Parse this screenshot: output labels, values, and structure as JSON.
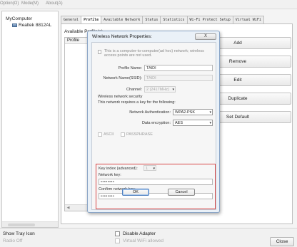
{
  "menu": {
    "items": [
      "Option(O)",
      "Mode(M)",
      "About(A)"
    ]
  },
  "tree": {
    "root": "MyComputer",
    "child": "Realtek 8812AL"
  },
  "tabs": [
    "General",
    "Profile",
    "Available Network",
    "Status",
    "Statistics",
    "Wi-Fi Protect Setup",
    "Virtual WiFi"
  ],
  "profile_panel": {
    "available_label": "Available Profile(s)",
    "list_header": "Profile",
    "buttons": [
      "Add",
      "Remove",
      "Edit",
      "Duplicate",
      "Set Default"
    ]
  },
  "bottom": {
    "show_tray": "Show Tray Icon",
    "radio_off": "Radio Off",
    "disable_adapter": "Disable Adapter",
    "virtual_wifi": "Virtual WiFi allowed",
    "close": "Close"
  },
  "dialog": {
    "title": "Wireless Network Properties:",
    "close_glyph": "X",
    "adhoc_text": "This is a computer-to-computer(ad hoc) network; wireless access points are not used.",
    "profile_name_label": "Profile Name:",
    "profile_name_value": "TAIDI",
    "ssid_label": "Network Name(SSID):",
    "ssid_value": "TAIDI",
    "channel_label": "Channel:",
    "channel_value": "2 (2417MHz)",
    "security_title": "Wireless network security",
    "security_text": "This network requires a key for the following:",
    "auth_label": "Network Authentication:",
    "auth_value": "WPA2-PSK",
    "enc_label": "Data encryption:",
    "enc_value": "AES",
    "ascii_label": "ASCII",
    "passphrase_label": "PASSPHRASE",
    "key_index_label": "Key index (advanced):",
    "key_index_value": "1",
    "network_key_label": "Network key:",
    "network_key_value": "••••••••",
    "confirm_key_label": "Confirm network key:",
    "confirm_key_value": "••••••••",
    "ok": "OK",
    "cancel": "Cancel"
  },
  "colors": {
    "highlight_box": "#d94848",
    "dialog_frame": "#eaf1f8"
  }
}
